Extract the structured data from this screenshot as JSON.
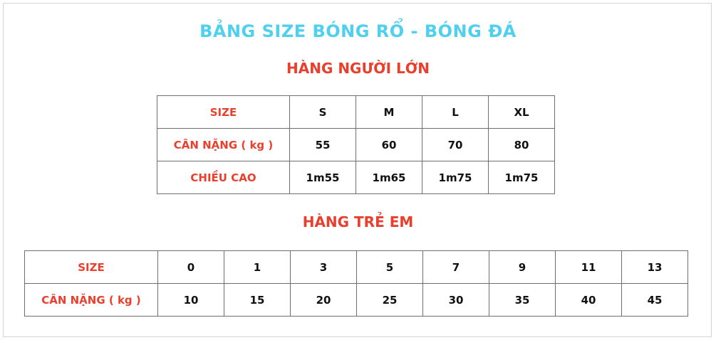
{
  "title": "BẢNG SIZE BÓNG RỔ - BÓNG ĐÁ",
  "colors": {
    "title": "#4fd0ee",
    "accent": "#e8402d",
    "text": "#111111",
    "border": "#6f6f6f"
  },
  "adult": {
    "heading": "HÀNG NGƯỜI LỚN",
    "rows": [
      {
        "label": "SIZE",
        "values": [
          "S",
          "M",
          "L",
          "XL"
        ]
      },
      {
        "label": "CÂN NẶNG ( kg )",
        "values": [
          "55",
          "60",
          "70",
          "80"
        ]
      },
      {
        "label": "CHIỀU CAO",
        "values": [
          "1m55",
          "1m65",
          "1m75",
          "1m75"
        ]
      }
    ]
  },
  "kids": {
    "heading": "HÀNG TRẺ EM",
    "rows": [
      {
        "label": "SIZE",
        "values": [
          "0",
          "1",
          "3",
          "5",
          "7",
          "9",
          "11",
          "13"
        ]
      },
      {
        "label": "CÂN NẶNG ( kg )",
        "values": [
          "10",
          "15",
          "20",
          "25",
          "30",
          "35",
          "40",
          "45"
        ]
      }
    ]
  }
}
